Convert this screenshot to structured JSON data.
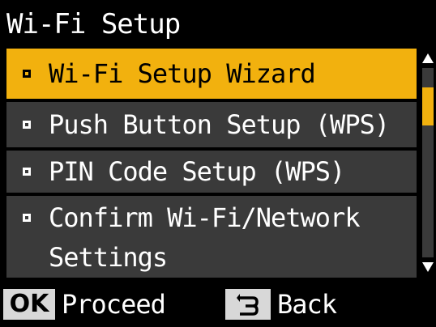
{
  "header": {
    "title": "Wi-Fi Setup"
  },
  "menu": {
    "items": [
      {
        "label": "Wi-Fi Setup Wizard",
        "selected": true
      },
      {
        "label": "Push Button Setup (WPS)",
        "selected": false
      },
      {
        "label": "PIN Code Setup (WPS)",
        "selected": false
      },
      {
        "label": "Confirm Wi-Fi/Network",
        "label_line2": "Settings",
        "selected": false
      }
    ]
  },
  "scroll": {
    "position_fraction": 0.0,
    "visible_fraction": 0.2
  },
  "footer": {
    "ok_key": "OK",
    "ok_label": "Proceed",
    "back_icon": "back-arrow-icon",
    "back_label": "Back"
  },
  "colors": {
    "highlight": "#f2b10e",
    "item_background": "#3a3a3a",
    "screen_background": "#000000",
    "key_badge": "#d8d8d8"
  }
}
